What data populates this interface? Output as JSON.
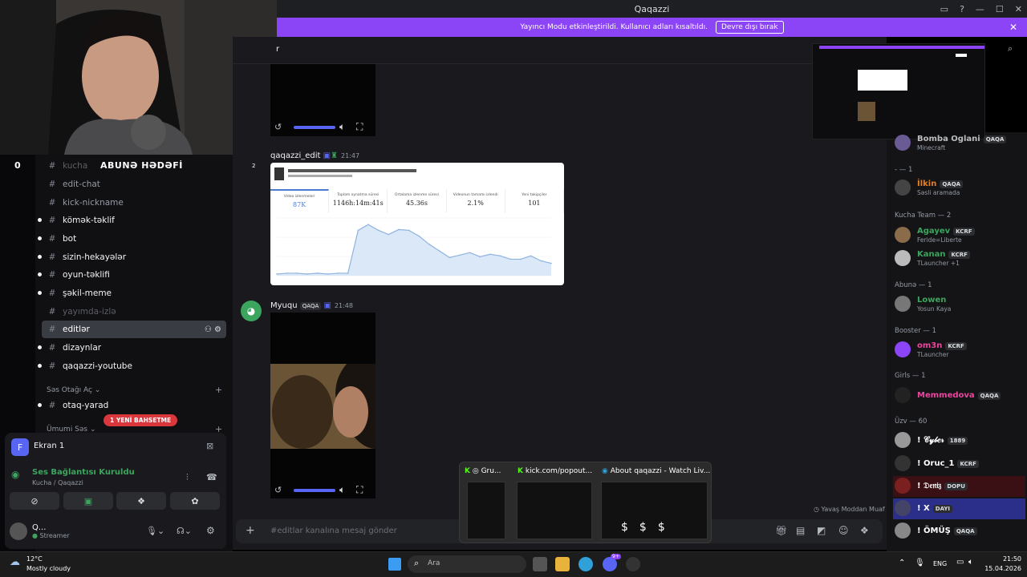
{
  "window": {
    "title": "Qaqazzi"
  },
  "banner": {
    "text": "Yayıncı Modu etkinleştirildi. Kullanıcı adları kısaltıldı.",
    "button": "Devre dışı bırak"
  },
  "overlay": {
    "subgoal_label": "ABUNƏ HƏDƏFİ",
    "subgoal_count": "0"
  },
  "channel_header": {
    "name": "r"
  },
  "channels": [
    {
      "name": "kucha",
      "state": "muted"
    },
    {
      "name": "edit-chat",
      "state": "normal"
    },
    {
      "name": "kick-nickname",
      "state": "normal"
    },
    {
      "name": "kömək-təklif",
      "state": "unread"
    },
    {
      "name": "bot",
      "state": "unread"
    },
    {
      "name": "sizin-hekayələr",
      "state": "unread"
    },
    {
      "name": "oyun-təklifi",
      "state": "unread"
    },
    {
      "name": "şəkil-meme",
      "state": "unread"
    },
    {
      "name": "yayımda-izlə",
      "state": "muted"
    },
    {
      "name": "editlər",
      "state": "selected"
    },
    {
      "name": "dizaynlar",
      "state": "unread"
    },
    {
      "name": "qaqazzi-youtube",
      "state": "unread"
    }
  ],
  "categories": {
    "voice": "Səs Otağı Aç",
    "general_voice": "Ümumi Səs"
  },
  "voice_channels": [
    {
      "name": "otaq-yarad"
    }
  ],
  "new_mention_pill": "1 YENİ BAHSETME",
  "screen_share": {
    "label": "Ekran 1",
    "initial": "F"
  },
  "voice_status": {
    "title": "Ses Bağlantısı Kuruldu",
    "subtitle": "Kucha / Qaqazzi"
  },
  "user": {
    "name": "Q...",
    "status": "Streamer"
  },
  "messages": [
    {
      "author": "qaqazzi_edit",
      "time": "21:47",
      "badge": "2"
    },
    {
      "author": "Myuqu",
      "tag": "QAQA",
      "time": "21:48"
    }
  ],
  "stats_card": {
    "stats": [
      {
        "label": "Video izlenmeleri",
        "value": "87K"
      },
      {
        "label": "Toplam oynatma süresi",
        "value": "1146h:14m:41s"
      },
      {
        "label": "Ortalama izlenme süresi",
        "value": "45.36s"
      },
      {
        "label": "Videonun tamamı izlendi",
        "value": "2.1%"
      },
      {
        "label": "Yeni takipçiler",
        "value": "101"
      }
    ]
  },
  "chart_data": {
    "type": "area",
    "values": [
      2,
      3,
      3,
      2,
      3,
      2,
      3,
      3,
      55,
      62,
      55,
      50,
      56,
      55,
      48,
      38,
      30,
      22,
      25,
      28,
      23,
      26,
      24,
      20,
      20,
      24,
      18,
      15
    ]
  },
  "composer": {
    "placeholder": "#editlar kanalına mesaj gönder"
  },
  "slow_mode": "Yavaş Moddan Muaf",
  "member_groups": [
    {
      "label": "- — 1"
    },
    {
      "label": "Kucha Team — 2"
    },
    {
      "label": "Abunə — 1"
    },
    {
      "label": "Booster — 1"
    },
    {
      "label": "Girls — 1"
    },
    {
      "label": "Üzv — 60"
    }
  ],
  "members": [
    {
      "name": "Bomba Oglani",
      "tag": "QAQA",
      "status": "Minecraft",
      "color": "#b9bbbe"
    },
    {
      "name": "İlkin",
      "tag": "QAQA",
      "status": "Səsli aramada",
      "color": "#e67e22"
    },
    {
      "name": "Agayev",
      "tag": "KCRF",
      "status": "Feride=Liberte",
      "color": "#3ba55d"
    },
    {
      "name": "Kanan",
      "tag": "KCRF",
      "status": "TLauncher +1",
      "color": "#3ba55d"
    },
    {
      "name": "Lowen",
      "tag": "",
      "status": "Yosun Kaya",
      "color": "#3ba55d"
    },
    {
      "name": "om3n",
      "tag": "KCRF",
      "status": "TLauncher",
      "color": "#eb459e"
    },
    {
      "name": "Memmedova",
      "tag": "QAQA",
      "status": "",
      "color": "#eb459e"
    },
    {
      "name": "! 𝒞𝓎𝒷𝑒𝓇",
      "tag": "1889",
      "status": "",
      "color": "#ffffff"
    },
    {
      "name": "! Oruc_1",
      "tag": "KCRF",
      "status": "",
      "color": "#ffffff"
    },
    {
      "name": "! 𝔇𝔢𝔫𝔦𝔷",
      "tag": "DOPU",
      "status": "",
      "color": "#ffffff"
    },
    {
      "name": "! X",
      "tag": "DAYI",
      "status": "",
      "color": "#ffffff"
    },
    {
      "name": "! ÖMÜŞ",
      "tag": "QAQA",
      "status": "",
      "color": "#ffffff"
    }
  ],
  "taskbar": {
    "weather_temp": "12°C",
    "weather_desc": "Mostly cloudy",
    "search_placeholder": "Ara",
    "lang": "ENG",
    "time": "21:50",
    "date": "15.04.2026",
    "discord_badge": "9+"
  },
  "task_popup": {
    "items": [
      {
        "title": "Gru..."
      },
      {
        "title": "kick.com/popout..."
      },
      {
        "title": "About qaqazzi - Watch Liv..."
      }
    ]
  }
}
